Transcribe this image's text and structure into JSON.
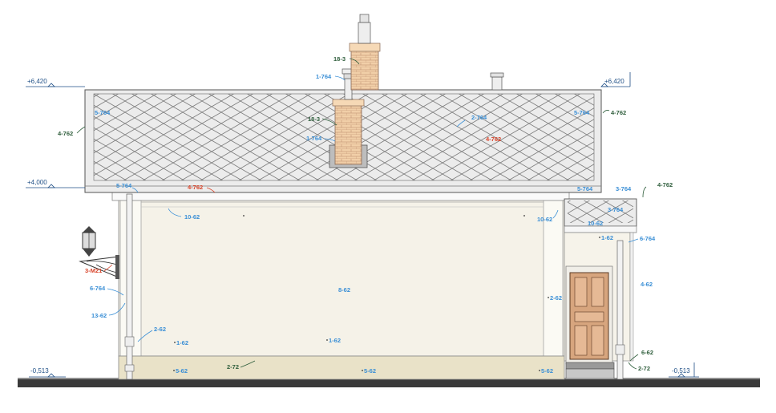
{
  "drawing": {
    "levels": {
      "ridge_left": "+6,420",
      "ridge_right": "+6,420",
      "eave_left": "+4,000",
      "ground_left": "-0,513",
      "ground_right": "-0,513"
    },
    "callouts": {
      "chimney_top": "18-3",
      "chimney_cap": "1-764",
      "chimney_mid": "18-3",
      "chimney_base": "1-764",
      "roof_left_edge": "5-764",
      "roof_right_edge": "5-764",
      "roof_center": "2-764",
      "roof_red": "4-762",
      "roof_gable_left": "4-762",
      "roof_gable_right": "4-762",
      "eave_left": "5-764",
      "eave_red": "4-762",
      "cornice_left": "10-62",
      "cornice_right": "10-62",
      "porch_eave": "5-764",
      "porch_roof_top": "3-764",
      "porch_roof_side": "4-762",
      "porch_roof_mid": "3-764",
      "porch_soffit": "10-62",
      "porch_trim": "1-62",
      "porch_post_cap": "6-764",
      "porch_wall": "4-62",
      "lantern": "3-M21",
      "downpipe": "6-764",
      "pilaster": "13-62",
      "plinth_left_top": "2-62",
      "wall_main": "8-62",
      "wall_right": "2-62",
      "base_left": "1-62",
      "base_center": "1-62",
      "plinth_left": "5-62",
      "plinth_center": "5-62",
      "plinth_right": "5-62",
      "plinth_strip": "2-72",
      "porch_base": "6-62",
      "porch_step": "2-72"
    }
  },
  "colors": {
    "roof_fill": "#e9e9e9",
    "roof_lines": "#7a7a7a",
    "wall": "#f5f2e8",
    "plinth": "#e9e2c8",
    "brick": "#f1cfa8",
    "door": "#d7a57e",
    "label_blue": "#3a8fd6",
    "label_green": "#2f5e3c",
    "label_red": "#d9452b",
    "ground": "#333333"
  }
}
